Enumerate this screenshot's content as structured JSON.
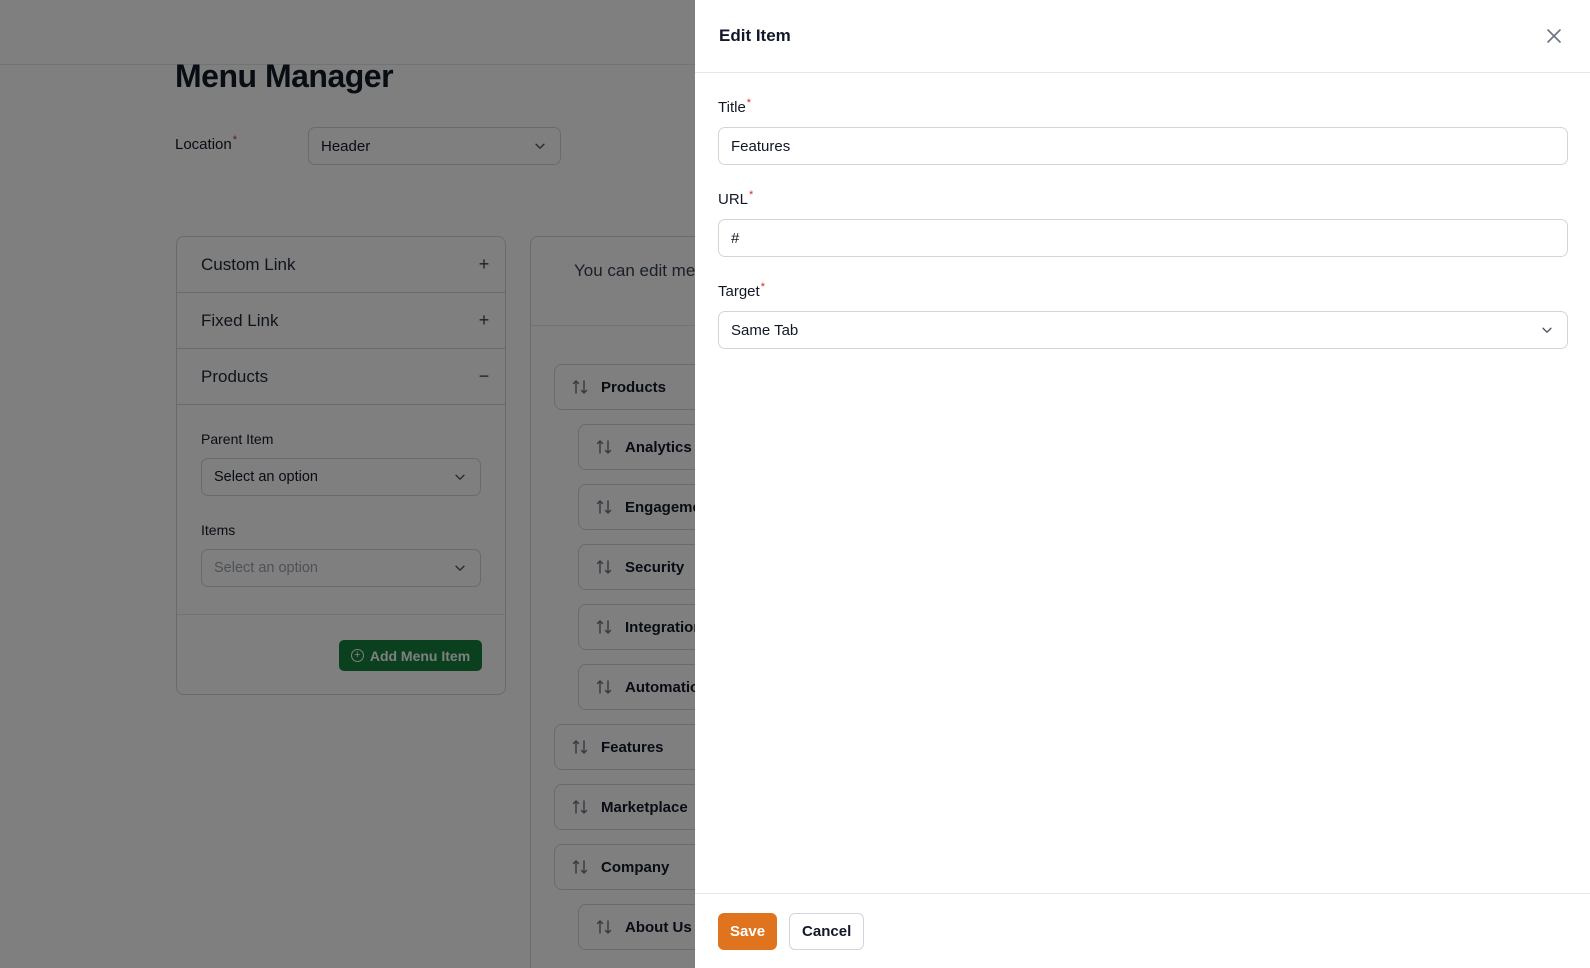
{
  "page": {
    "title": "Menu Manager",
    "location_label": "Location",
    "location_value": "Header",
    "required_mark": "*"
  },
  "left_panel": {
    "accordions": [
      {
        "label": "Custom Link",
        "sign": "+"
      },
      {
        "label": "Fixed Link",
        "sign": "+"
      },
      {
        "label": "Products",
        "sign": "−"
      }
    ],
    "parent_item_label": "Parent Item",
    "parent_item_value": "Select an option",
    "items_label": "Items",
    "items_placeholder": "Select an option",
    "add_button_label": "Add Menu Item"
  },
  "menu_panel": {
    "hint": "You can edit menu items by clicking the pencil icon on each item.",
    "items": [
      {
        "label": "Products",
        "level": 0
      },
      {
        "label": "Analytics",
        "level": 1
      },
      {
        "label": "Engagement",
        "level": 1
      },
      {
        "label": "Security",
        "level": 1
      },
      {
        "label": "Integrations",
        "level": 1
      },
      {
        "label": "Automation",
        "level": 1
      },
      {
        "label": "Features",
        "level": 0
      },
      {
        "label": "Marketplace",
        "level": 0
      },
      {
        "label": "Company",
        "level": 0
      },
      {
        "label": "About Us",
        "level": 1
      }
    ]
  },
  "drawer": {
    "title": "Edit Item",
    "title_field_label": "Title",
    "title_field_value": "Features",
    "url_field_label": "URL",
    "url_field_value": "#",
    "target_label": "Target",
    "target_value": "Same Tab",
    "save_label": "Save",
    "cancel_label": "Cancel"
  },
  "colors": {
    "accent_save": "#e0731e",
    "add_button": "#15803d",
    "required": "#dc2626"
  }
}
